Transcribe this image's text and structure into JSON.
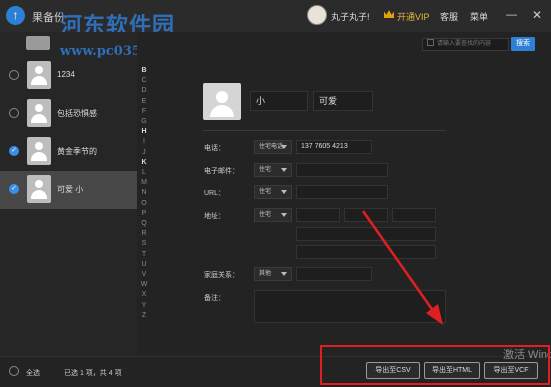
{
  "app": {
    "title": "果备份",
    "logo_glyph": "↑",
    "watermark_text": "河东软件园",
    "watermark_url": "www.pc0359.cn"
  },
  "topbar": {
    "user_name": "丸子丸子!",
    "vip_label": "开通VIP",
    "service_label": "客服",
    "menu_label": "菜单",
    "minimize_glyph": "—",
    "close_glyph": "✕",
    "vip_color": "#e8b63a"
  },
  "search": {
    "placeholder": "请输入要查找的内容",
    "button_label": "搜索",
    "button_color": "#2e7fd6"
  },
  "contacts": [
    {
      "name": "1234",
      "state": "unchecked",
      "selected": false
    },
    {
      "name": "包括恐惧感",
      "state": "unchecked",
      "selected": false
    },
    {
      "name": "黄金季节的",
      "state": "checked",
      "selected": false
    },
    {
      "name": "可爱 小",
      "state": "checked",
      "selected": true
    }
  ],
  "alphabet": [
    "B",
    "C",
    "D",
    "E",
    "F",
    "G",
    "H",
    "I",
    "J",
    "K",
    "L",
    "M",
    "N",
    "O",
    "P",
    "Q",
    "R",
    "S",
    "T",
    "U",
    "V",
    "W",
    "X",
    "Y",
    "Z"
  ],
  "alphabet_bold": [
    "B",
    "H",
    "K"
  ],
  "detail": {
    "first_name": "小",
    "last_name": "可爱",
    "phone_label": "电话：",
    "phone_type": "住宅电话",
    "phone_value": "137 7605 4213",
    "email_label": "电子邮件：",
    "email_type": "住宅",
    "url_label": "URL：",
    "url_type": "住宅",
    "address_label": "地址：",
    "address_type": "住宅",
    "family_label": "家庭关系：",
    "family_type": "其他",
    "notes_label": "备注："
  },
  "bottom": {
    "select_all_label": "全选",
    "selection_status": "已选 1 项，共 4 项",
    "export_csv": "导出至CSV",
    "export_html": "导出至HTML",
    "export_vcf": "导出至VCF",
    "activate_text": "激活 Wind"
  },
  "annotation_color": "#e02020"
}
